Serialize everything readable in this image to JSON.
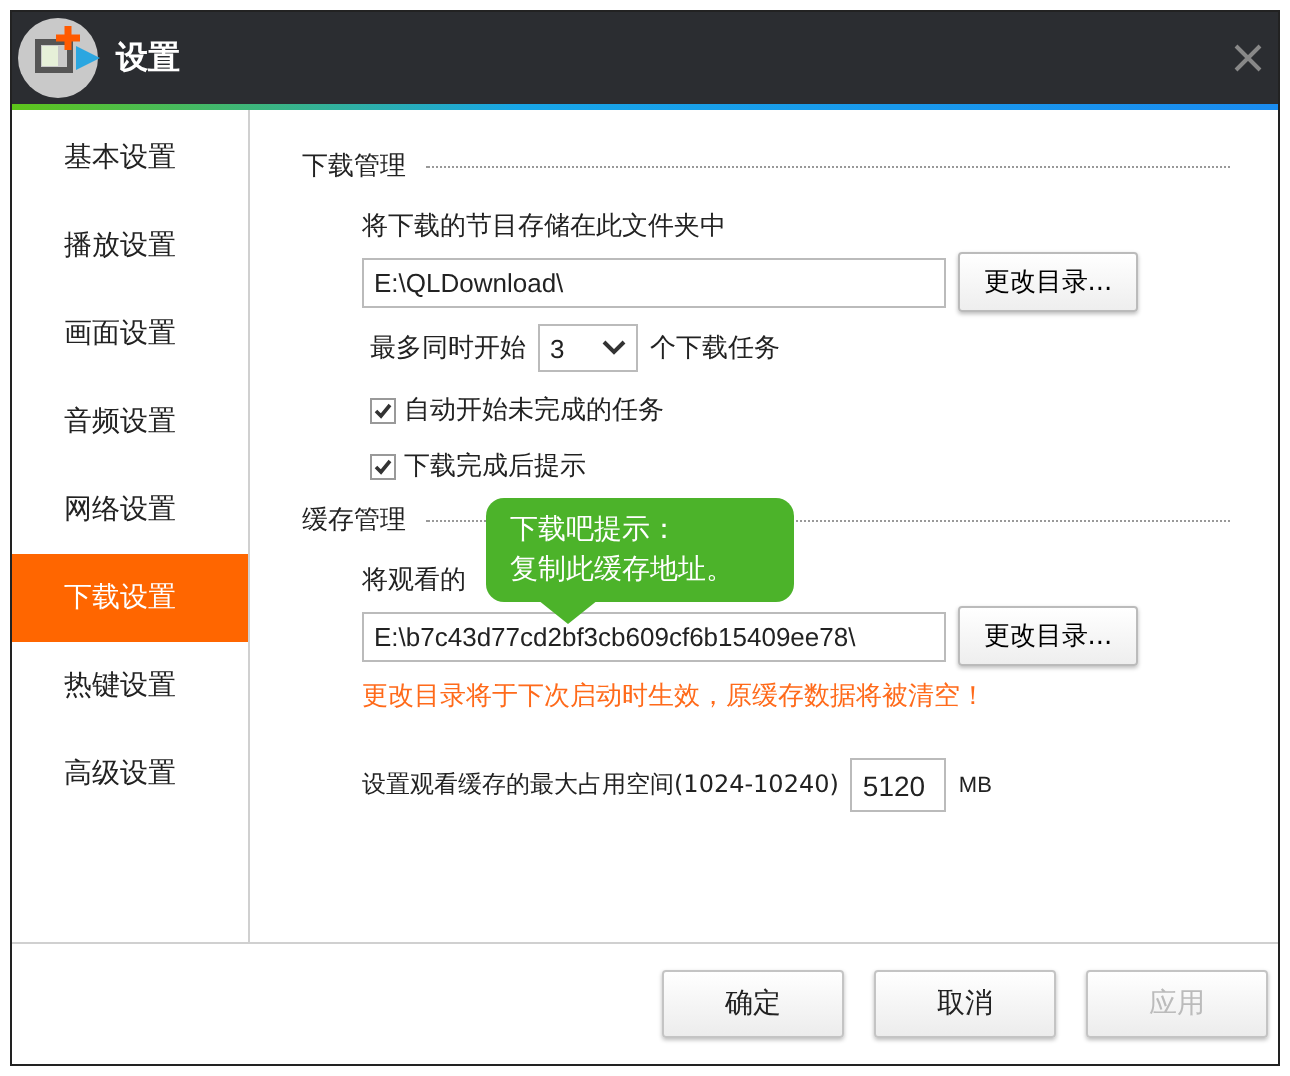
{
  "window": {
    "title": "设置"
  },
  "sidebar": {
    "items": [
      {
        "label": "基本设置",
        "selected": false
      },
      {
        "label": "播放设置",
        "selected": false
      },
      {
        "label": "画面设置",
        "selected": false
      },
      {
        "label": "音频设置",
        "selected": false
      },
      {
        "label": "网络设置",
        "selected": false
      },
      {
        "label": "下载设置",
        "selected": true
      },
      {
        "label": "热键设置",
        "selected": false
      },
      {
        "label": "高级设置",
        "selected": false
      }
    ]
  },
  "download": {
    "heading": "下载管理",
    "folder_label": "将下载的节目存储在此文件夹中",
    "folder_value": "E:\\QLDownload\\",
    "change_button": "更改目录...",
    "max_prefix": "最多同时开始",
    "max_value": "3",
    "max_suffix": "个下载任务",
    "checkboxes": [
      {
        "label": "自动开始未完成的任务",
        "checked": true
      },
      {
        "label": "下载完成后提示",
        "checked": true
      }
    ]
  },
  "cache": {
    "heading": "缓存管理",
    "folder_label": "将观看的",
    "folder_value": "E:\\b7c43d77cd2bf3cb609cf6b15409ee78\\",
    "change_button": "更改目录...",
    "warning": "更改目录将于下次启动时生效，原缓存数据将被清空！",
    "size_label": "设置观看缓存的最大占用空间(1024-10240)",
    "size_value": "5120",
    "size_unit": "MB"
  },
  "tooltip": {
    "title": "下载吧提示：",
    "text": "复制此缓存地址。"
  },
  "buttons": [
    {
      "label": "确定",
      "disabled": false
    },
    {
      "label": "取消",
      "disabled": false
    },
    {
      "label": "应用",
      "disabled": true
    }
  ]
}
